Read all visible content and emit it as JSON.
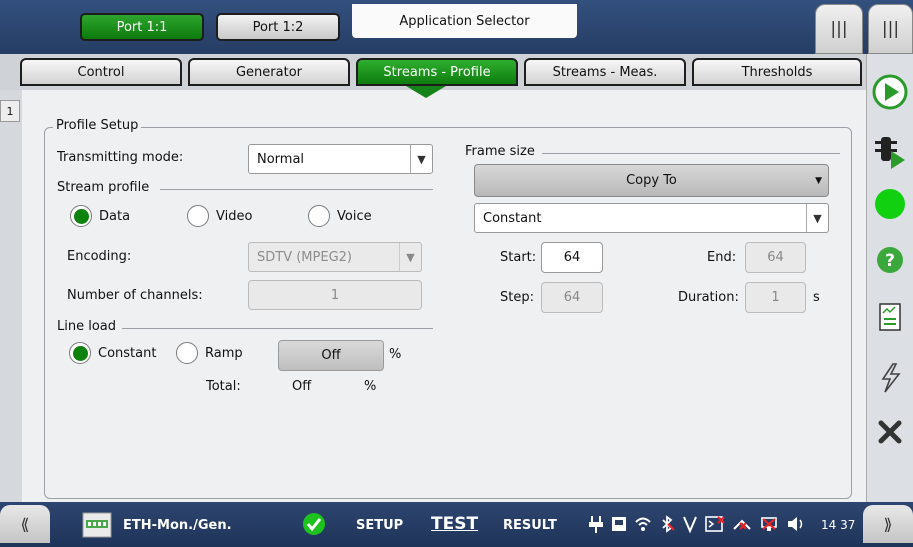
{
  "ports": [
    {
      "label": "Port 1:1",
      "active": true
    },
    {
      "label": "Port 1:2",
      "active": false
    }
  ],
  "app_selector": "Application Selector",
  "top_right_buttons": [
    "|||",
    "|||"
  ],
  "tabs": [
    "Control",
    "Generator",
    "Streams - Profile",
    "Streams - Meas.",
    "Thresholds"
  ],
  "active_tab": "Streams - Profile",
  "panel_number": "1",
  "profile_setup": {
    "title": "Profile Setup",
    "transmitting_mode_label": "Transmitting mode:",
    "transmitting_mode_value": "Normal",
    "stream_profile_title": "Stream profile",
    "profile_options": [
      "Data",
      "Video",
      "Voice"
    ],
    "profile_selected": "Data",
    "encoding_label": "Encoding:",
    "encoding_value": "SDTV (MPEG2)",
    "channels_label": "Number of channels:",
    "channels_value": "1",
    "line_load_title": "Line load",
    "load_options": [
      "Constant",
      "Ramp"
    ],
    "load_selected": "Constant",
    "load_value": "Off",
    "load_unit": "%",
    "total_label": "Total:",
    "total_value": "Off",
    "total_unit": "%"
  },
  "frame_size": {
    "title": "Frame size",
    "copy_to": "Copy To",
    "mode_value": "Constant",
    "start_label": "Start:",
    "start_value": "64",
    "end_label": "End:",
    "end_value": "64",
    "step_label": "Step:",
    "step_value": "64",
    "duration_label": "Duration:",
    "duration_value": "1",
    "duration_unit": "s"
  },
  "status_bar": {
    "left_chevron": "⟪",
    "right_chevron": "⟫",
    "app_name": "ETH-Mon./Gen.",
    "setup": "SETUP",
    "test": "TEST",
    "result": "RESULT",
    "clock": "14 37"
  },
  "colors": {
    "accent_green": "#0d820d",
    "frame_blue": "#2b3f63",
    "panel_bg": "#eef0f2"
  }
}
